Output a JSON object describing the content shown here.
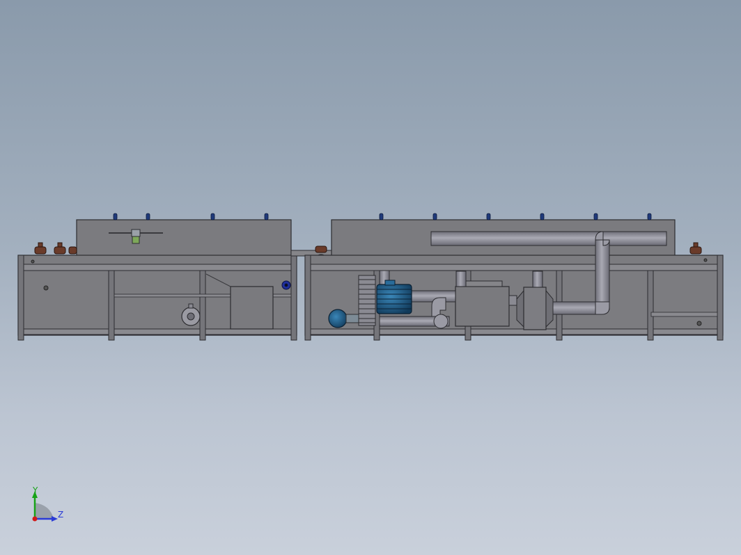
{
  "viewport": {
    "background_top": "#8a9aab",
    "background_bottom": "#c9d0db"
  },
  "model": {
    "frame_color": "#6f6f75",
    "panel_color": "#7c7c80",
    "edge_color": "#2c2c30",
    "pipe_color": "#8c8c96",
    "motor_color": "#1f5f8c",
    "roller_color": "#6a3b2a",
    "bolt_color": "#1f3a7a",
    "valve_color": "#7ea85a"
  },
  "triad": {
    "y_label": "Y",
    "z_label": "Z",
    "y_color": "#17a317",
    "z_color": "#2a3bd6",
    "origin_color": "#d21a1a"
  }
}
